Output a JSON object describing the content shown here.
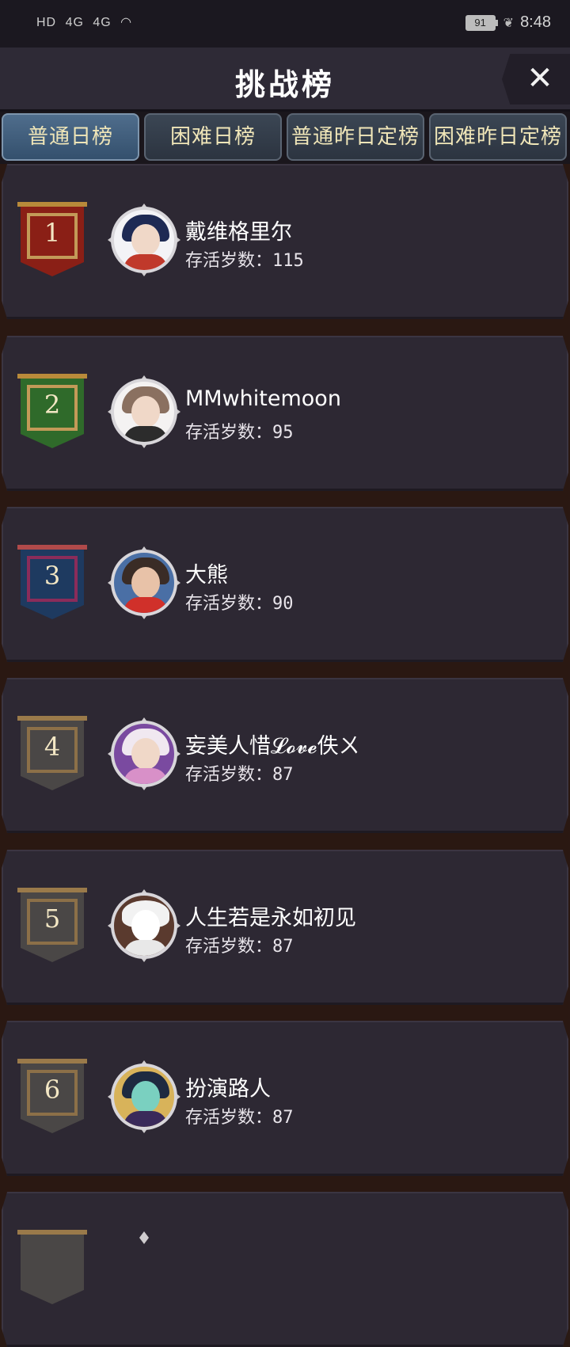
{
  "status_bar": {
    "left_icons": [
      "HD",
      "4G",
      "4G"
    ],
    "battery": "91",
    "time": "8:48"
  },
  "header": {
    "title": "挑战榜",
    "close_label": "✕"
  },
  "tabs": [
    {
      "label": "普通日榜",
      "active": true
    },
    {
      "label": "困难日榜",
      "active": false
    },
    {
      "label": "普通昨日定榜",
      "active": false
    },
    {
      "label": "困难昨日定榜",
      "active": false
    }
  ],
  "colors": {
    "rank_1": "#8a1f16",
    "rank_2": "#2f6a2a",
    "rank_3": "#1e3a60",
    "rank_default": "#4a4746"
  },
  "rankings": [
    {
      "rank": "1",
      "name": "戴维格里尔",
      "score_label": "存活岁数：",
      "score": "115"
    },
    {
      "rank": "2",
      "name": "MMwhitemoon",
      "score_label": "存活岁数：",
      "score": "95"
    },
    {
      "rank": "3",
      "name": "大熊",
      "score_label": "存活岁数：",
      "score": "90"
    },
    {
      "rank": "4",
      "name": "妄美人惜𝓛𝓸𝓿𝓮佚ㄨ",
      "score_label": "存活岁数：",
      "score": "87"
    },
    {
      "rank": "5",
      "name": "人生若是永如初见",
      "score_label": "存活岁数：",
      "score": "87"
    },
    {
      "rank": "6",
      "name": "扮演路人",
      "score_label": "存活岁数：",
      "score": "87"
    }
  ]
}
